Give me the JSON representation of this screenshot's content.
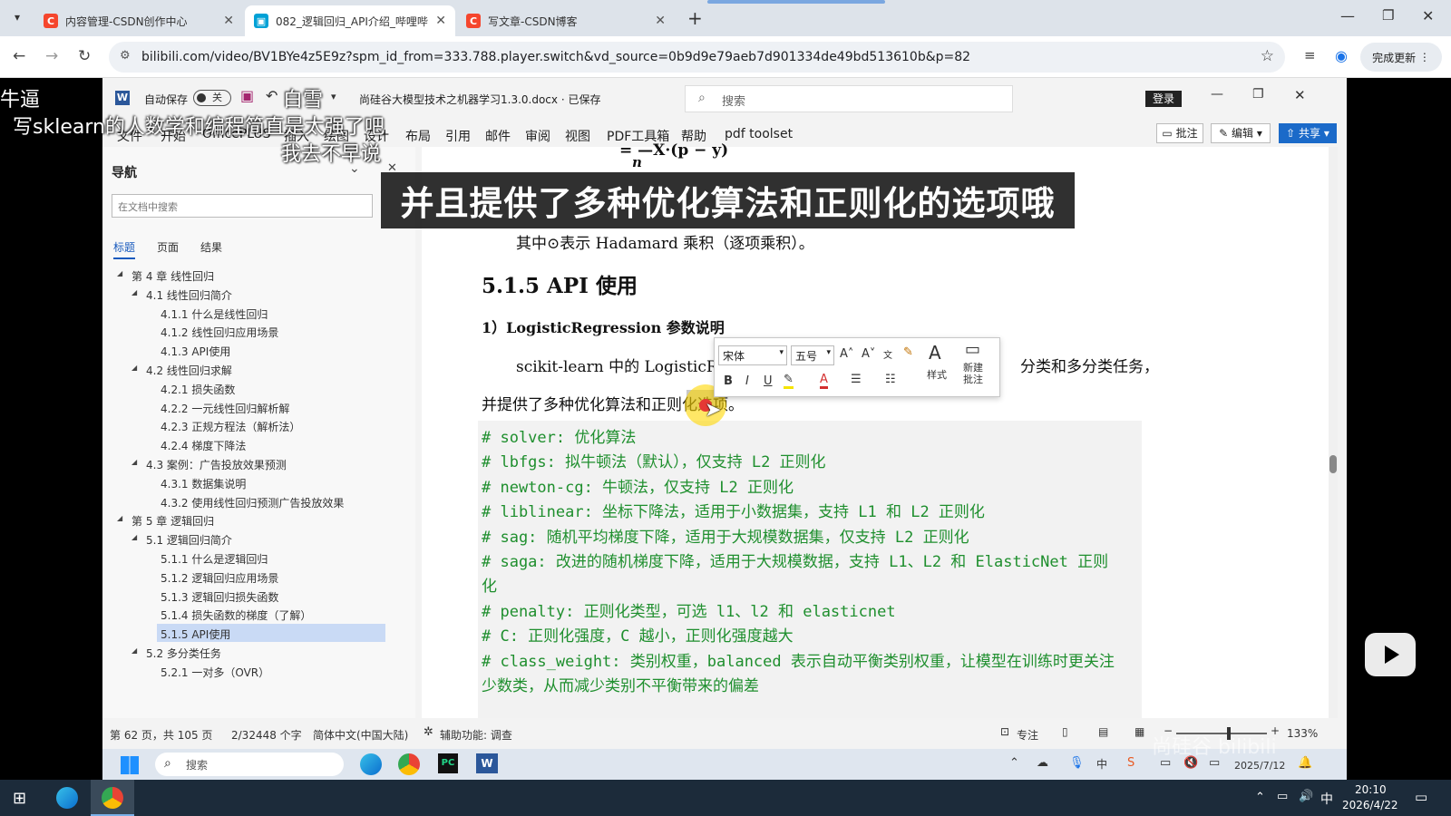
{
  "browser": {
    "tabs": [
      {
        "label": "内容管理-CSDN创作中心",
        "icon": "csdn-icon",
        "color": "#f5462d"
      },
      {
        "label": "082_逻辑回归_API介绍_哔哩哔",
        "icon": "bilibili-icon",
        "color": "#00a1d6"
      },
      {
        "label": "写文章-CSDN博客",
        "icon": "csdn-icon",
        "color": "#f5462d"
      }
    ],
    "url": "bilibili.com/video/BV1BYe4z5E9z?spm_id_from=333.788.player.switch&vd_source=0b9d9e79aeb7d901334de49bd513610b&p=82",
    "finish_update": "完成更新"
  },
  "word": {
    "autosave_label": "自动保存",
    "autosave_state": "关",
    "doc_title": "尚硅谷大模型技术之机器学习1.3.0.docx · 已保存",
    "search_placeholder": "搜索",
    "login": "登录",
    "menus": [
      "文件",
      "开始",
      "OfficePLUS",
      "插入",
      "绘图",
      "设计",
      "布局",
      "引用",
      "邮件",
      "审阅",
      "视图",
      "PDF工具箱",
      "帮助",
      "pdf toolset"
    ],
    "comment_btn": "批注",
    "edit_btn": "编辑",
    "share_btn": "共享",
    "nav": {
      "title": "导航",
      "search_placeholder": "在文档中搜索",
      "tabs": [
        "标题",
        "页面",
        "结果"
      ],
      "items": [
        {
          "label": "第 4 章 线性回归",
          "level": 1
        },
        {
          "label": "4.1 线性回归简介",
          "level": 2
        },
        {
          "label": "4.1.1 什么是线性回归",
          "level": 3
        },
        {
          "label": "4.1.2 线性回归应用场景",
          "level": 3
        },
        {
          "label": "4.1.3 API使用",
          "level": 3
        },
        {
          "label": "4.2 线性回归求解",
          "level": 2
        },
        {
          "label": "4.2.1 损失函数",
          "level": 3
        },
        {
          "label": "4.2.2 一元线性回归解析解",
          "level": 3
        },
        {
          "label": "4.2.3 正规方程法（解析法）",
          "level": 3
        },
        {
          "label": "4.2.4 梯度下降法",
          "level": 3
        },
        {
          "label": "4.3 案例：广告投放效果预测",
          "level": 2
        },
        {
          "label": "4.3.1 数据集说明",
          "level": 3
        },
        {
          "label": "4.3.2 使用线性回归预测广告投放效果",
          "level": 3
        },
        {
          "label": "第 5 章 逻辑回归",
          "level": 1
        },
        {
          "label": "5.1 逻辑回归简介",
          "level": 2
        },
        {
          "label": "5.1.1 什么是逻辑回归",
          "level": 3
        },
        {
          "label": "5.1.2 逻辑回归应用场景",
          "level": 3
        },
        {
          "label": "5.1.3 逻辑回归损失函数",
          "level": 3
        },
        {
          "label": "5.1.4 损失函数的梯度（了解）",
          "level": 3
        },
        {
          "label": "5.1.5 API使用",
          "level": 3,
          "selected": true
        },
        {
          "label": "5.2 多分类任务",
          "level": 2
        },
        {
          "label": "5.2.1 一对多（OVR）",
          "level": 3
        }
      ]
    },
    "doc": {
      "formula_top": "= —X·(p − y)",
      "formula_n": "n",
      "hadamard": "其中⊙表示 Hadamard 乘积（逐项乘积）。",
      "heading": "5.1.5 API 使用",
      "subheading": "1）LogisticRegression 参数说明",
      "para1_left": "scikit-learn 中的 LogisticReg",
      "para1_right": "分类和多分类任务，",
      "para2": "并提供了多种优化算法和正则化选项。",
      "code_lines": [
        "# solver: 优化算法",
        "#   lbfgs: 拟牛顿法（默认），仅支持 L2 正则化",
        "#   newton-cg: 牛顿法，仅支持 L2 正则化",
        "#   liblinear: 坐标下降法，适用于小数据集，支持 L1 和 L2 正则化",
        "#   sag: 随机平均梯度下降，适用于大规模数据集，仅支持 L2 正则化",
        "#   saga: 改进的随机梯度下降，适用于大规模数据，支持 L1、L2 和 ElasticNet 正则",
        "化",
        "# penalty: 正则化类型，可选 l1、l2 和 elasticnet",
        "# C: 正则化强度，C 越小，正则化强度越大",
        "# class_weight: 类别权重，balanced 表示自动平衡类别权重，让模型在训练时更关注",
        "少数类，从而减少类别不平衡带来的偏差"
      ]
    },
    "minitoolbar": {
      "font": "宋体",
      "size": "五号",
      "styles": "样式",
      "new_comment": "新建批注"
    },
    "status": {
      "page": "第 62 页，共 105 页",
      "words": "2/32448 个字",
      "lang": "简体中文(中国大陆)",
      "a11y": "辅助功能: 调查",
      "focus": "专注",
      "zoom": "133%"
    },
    "inner_taskbar": {
      "search": "搜索",
      "date": "2025/7/12"
    }
  },
  "video": {
    "subtitle": "并且提供了多种优化算法和正则化的选项哦",
    "danmaku": [
      "牛逼",
      "白雪",
      "写sklearn的人数学和编程简直是太强了吧",
      "我去不早说"
    ],
    "watermark": "尚硅谷 bilibili"
  },
  "taskbar": {
    "ime": "中",
    "time": "20:10",
    "date": "2026/4/22"
  }
}
